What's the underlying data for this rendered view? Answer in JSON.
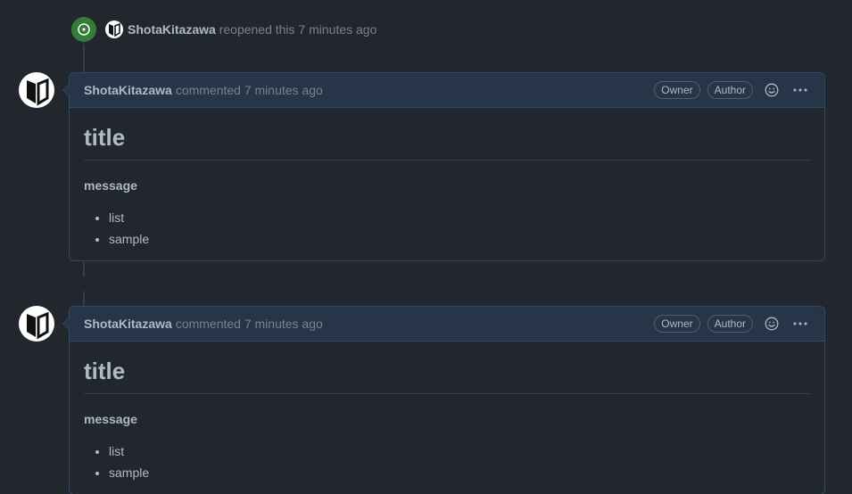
{
  "event": {
    "author": "ShotaKitazawa",
    "action": "reopened this 7 minutes ago",
    "icon": "issue-reopened-icon",
    "badge_color": "#347d39"
  },
  "comments": [
    {
      "author": "ShotaKitazawa",
      "meta": "commented 7 minutes ago",
      "labels": [
        "Owner",
        "Author"
      ],
      "title": "title",
      "message": "message",
      "list": [
        "list",
        "sample"
      ]
    },
    {
      "author": "ShotaKitazawa",
      "meta": "commented 7 minutes ago",
      "labels": [
        "Owner",
        "Author"
      ],
      "title": "title",
      "message": "message",
      "list": [
        "list",
        "sample"
      ]
    }
  ],
  "colors": {
    "background": "#22272e",
    "header": "#263548",
    "border": "#2f4a6e"
  }
}
